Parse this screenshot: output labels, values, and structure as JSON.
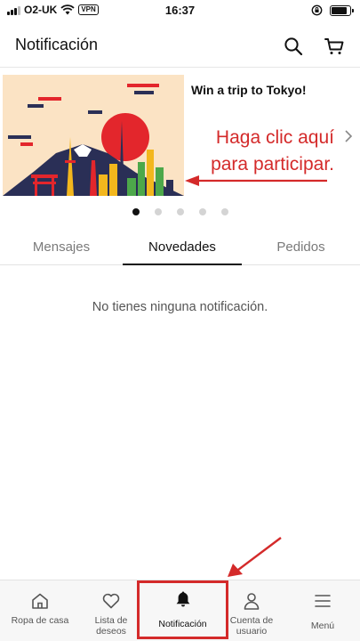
{
  "status_bar": {
    "carrier": "O2-UK",
    "vpn": "VPN",
    "time": "16:37",
    "battery_level": 0.85
  },
  "header": {
    "title": "Notificación",
    "icons": [
      "search-icon",
      "cart-icon"
    ]
  },
  "banner": {
    "title": "Win a trip to Tokyo!",
    "cta": "Haga clic aquí para participar.",
    "cta_color": "#d42a2a",
    "slides": 5,
    "active_slide": 1
  },
  "tabs": [
    {
      "label": "Mensajes",
      "active": false
    },
    {
      "label": "Novedades",
      "active": true
    },
    {
      "label": "Pedidos",
      "active": false
    }
  ],
  "empty_message": "No tienes ninguna notificación.",
  "bottom_nav": [
    {
      "label": "Ropa de casa",
      "icon": "home-icon",
      "active": false
    },
    {
      "label": "Lista de deseos",
      "icon": "heart-icon",
      "active": false
    },
    {
      "label": "Notificación",
      "icon": "bell-icon",
      "active": true
    },
    {
      "label": "Cuenta de usuario",
      "icon": "user-icon",
      "active": false
    },
    {
      "label": "Menú",
      "icon": "menu-icon",
      "active": false
    }
  ],
  "annotation_color": "#d42a2a"
}
